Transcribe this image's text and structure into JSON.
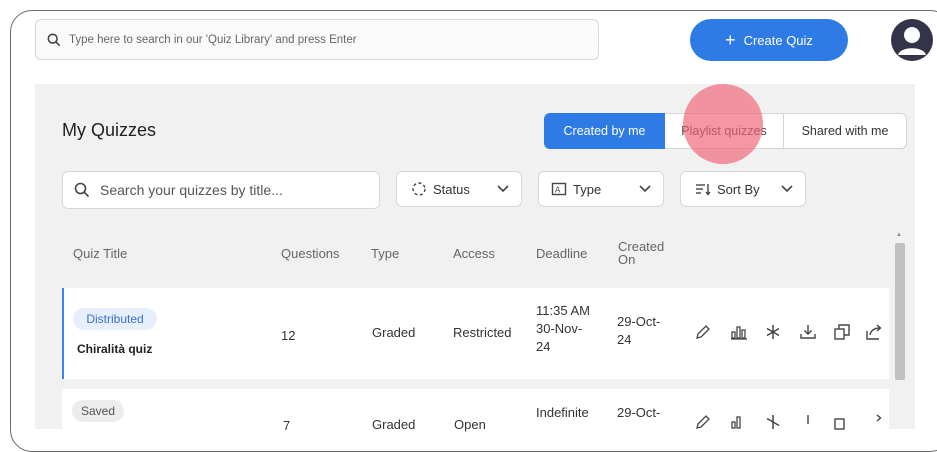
{
  "search": {
    "placeholder": "Type here to search in our 'Quiz Library' and press Enter"
  },
  "header": {
    "create_label": "Create Quiz",
    "create_plus": "+"
  },
  "page": {
    "title": "My Quizzes"
  },
  "tabs": [
    {
      "label": "Created by me",
      "active": true
    },
    {
      "label": "Playlist quizzes",
      "active": false
    },
    {
      "label": "Shared with me",
      "active": false
    }
  ],
  "filters": {
    "search_placeholder": "Search your quizzes by title...",
    "status_label": "Status",
    "type_label": "Type",
    "sort_label": "Sort By"
  },
  "table": {
    "headers": {
      "title": "Quiz Title",
      "questions": "Questions",
      "type": "Type",
      "access": "Access",
      "deadline": "Deadline",
      "created_line1": "Created",
      "created_line2": "On"
    },
    "rows": [
      {
        "status": "Distributed",
        "title": "Chiralità quiz",
        "questions": "12",
        "type": "Graded",
        "access": "Restricted",
        "deadline_l1": "11:35 AM",
        "deadline_l2": "30-Nov-",
        "deadline_l3": "24",
        "created_l1": "29-Oct-",
        "created_l2": "24"
      },
      {
        "status": "Saved",
        "title": "",
        "questions": "7",
        "type": "Graded",
        "access": "Open",
        "deadline_l1": "Indefinite",
        "created_l1": "29-Oct-"
      }
    ]
  },
  "colors": {
    "accent": "#2f7be5",
    "badge_distributed": "#e7effc",
    "badge_saved": "#ececec"
  },
  "icons": [
    "search-icon",
    "plus-icon",
    "user-icon",
    "status-icon",
    "type-icon",
    "sort-icon",
    "chevron-down-icon",
    "edit-icon",
    "report-icon",
    "asterisk-icon",
    "download-icon",
    "copy-icon",
    "share-icon"
  ]
}
